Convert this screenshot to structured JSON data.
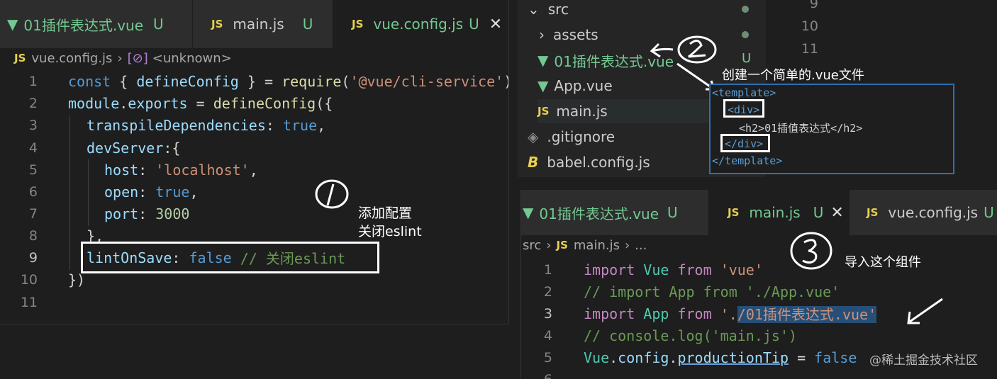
{
  "left": {
    "tabs": [
      {
        "label": "01插件表达式.vue",
        "status": "U",
        "kind": "vue"
      },
      {
        "label": "main.js",
        "status": "U",
        "kind": "js"
      },
      {
        "label": "vue.config.js",
        "status": "U",
        "kind": "js",
        "active": true
      }
    ],
    "breadcrumb": {
      "file": "vue.config.js",
      "symbol": "<unknown>"
    },
    "code": [
      {
        "n": "1",
        "t": "const { defineConfig } = require('@vue/cli-service')"
      },
      {
        "n": "2",
        "t": "module.exports = defineConfig({"
      },
      {
        "n": "3",
        "t": "transpileDependencies: true,"
      },
      {
        "n": "4",
        "t": "devServer:{"
      },
      {
        "n": "5",
        "t": "host: 'localhost',"
      },
      {
        "n": "6",
        "t": "open: true,"
      },
      {
        "n": "7",
        "t": "port: 3000"
      },
      {
        "n": "8",
        "t": "},"
      },
      {
        "n": "9",
        "t": "lintOnSave: false // 关闭eslint"
      },
      {
        "n": "10",
        "t": "})"
      },
      {
        "n": "11",
        "t": ""
      }
    ],
    "annotation_mark": "①",
    "annotation_line1": "添加配置",
    "annotation_line2": "关闭eslint"
  },
  "explorer": {
    "items": [
      {
        "label": "src",
        "icon": "chevron-down-icon"
      },
      {
        "label": "assets",
        "icon": "chevron-right-icon"
      },
      {
        "label": "01插件表达式.vue",
        "icon": "vue-icon",
        "status": "U"
      },
      {
        "label": "App.vue",
        "icon": "vue-icon"
      },
      {
        "label": "main.js",
        "icon": "js-icon"
      },
      {
        "label": ".gitignore",
        "icon": "git-icon"
      },
      {
        "label": "babel.config.js",
        "icon": "babel-icon"
      }
    ],
    "line_numbers": [
      "9",
      "10",
      "11"
    ],
    "annotation_mark": "②",
    "annotation_text": "创建一个简单的.vue文件"
  },
  "template_snippet": {
    "lines": [
      "<template>",
      "<div>",
      "<h2>01插值表达式</h2>",
      "</div>",
      "</template>"
    ]
  },
  "right": {
    "tabs": [
      {
        "label": "01插件表达式.vue",
        "status": "U",
        "kind": "vue"
      },
      {
        "label": "main.js",
        "status": "U",
        "kind": "js",
        "active": true
      },
      {
        "label": "vue.config.js",
        "status": "U",
        "kind": "js"
      }
    ],
    "breadcrumb": {
      "folder": "src",
      "file": "main.js",
      "more": "..."
    },
    "code": [
      {
        "n": "1",
        "t": "import Vue from 'vue'"
      },
      {
        "n": "2",
        "t": "// import App from './App.vue'"
      },
      {
        "n": "3",
        "t": "import App from './01插件表达式.vue'"
      },
      {
        "n": "4",
        "t": "// console.log('main.js')"
      },
      {
        "n": "5",
        "t": "Vue.config.productionTip = false"
      },
      {
        "n": "6",
        "t": ""
      }
    ],
    "annotation_mark": "③",
    "annotation_text": "导入这个组件"
  },
  "watermark": "@稀土掘金技术社区",
  "colors": {
    "vue_green": "#73c991",
    "js_yellow": "#e7d04f",
    "keyword": "#569cd6",
    "string": "#ce9178",
    "comment": "#6a9955",
    "selection": "#264f78"
  }
}
